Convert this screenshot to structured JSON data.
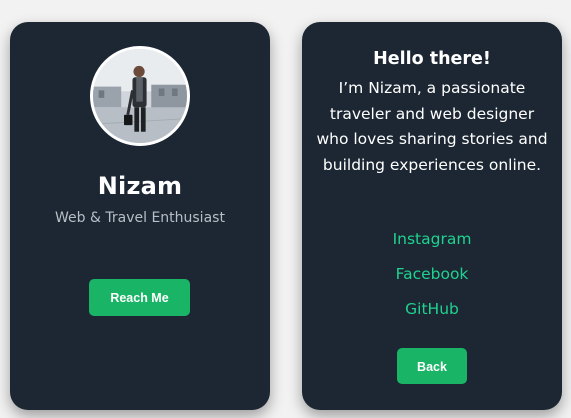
{
  "profile_card": {
    "name": "Nizam",
    "tagline": "Web & Travel Enthusiast",
    "reach_button_label": "Reach Me"
  },
  "about_card": {
    "greeting": "Hello there!",
    "bio": "I’m Nizam, a passionate traveler and web designer who loves sharing stories and building experiences online.",
    "links": {
      "instagram": "Instagram",
      "facebook": "Facebook",
      "github": "GitHub"
    },
    "back_button_label": "Back"
  },
  "colors": {
    "card_background": "#1c2733",
    "accent_green": "#19b466",
    "link_teal": "#1fd28f",
    "muted_text": "#b8bec5"
  },
  "icons": {
    "avatar": "profile-photo"
  }
}
